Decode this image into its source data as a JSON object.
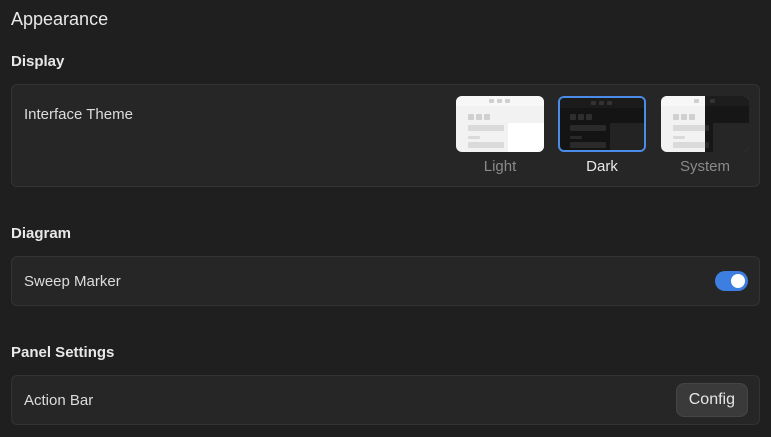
{
  "page": {
    "title": "Appearance"
  },
  "display": {
    "section_title": "Display",
    "interface_theme": {
      "label": "Interface Theme",
      "options": [
        {
          "label": "Light",
          "icon": "light-theme-preview"
        },
        {
          "label": "Dark",
          "icon": "dark-theme-preview"
        },
        {
          "label": "System",
          "icon": "system-theme-preview"
        }
      ],
      "selected": "Dark"
    }
  },
  "diagram": {
    "section_title": "Diagram",
    "sweep_marker": {
      "label": "Sweep Marker",
      "enabled": true
    }
  },
  "panel_settings": {
    "section_title": "Panel Settings",
    "action_bar": {
      "label": "Action Bar",
      "button_label": "Config"
    }
  },
  "colors": {
    "accent": "#3d7fe0",
    "background": "#1f1f1f",
    "card": "#262626"
  }
}
